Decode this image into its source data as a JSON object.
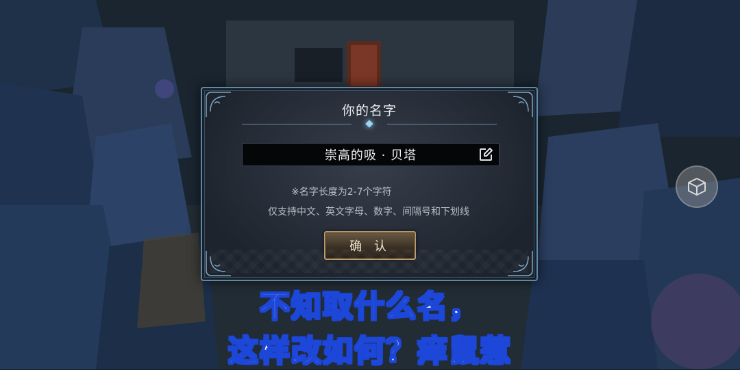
{
  "dialog": {
    "title": "你的名字",
    "name_value": "崇高的吸 · 贝塔",
    "hint_length": "※名字长度为2-7个字符",
    "hint_chars": "仅支持中文、英文字母、数字、间隔号和下划线",
    "confirm_label": "确 认"
  },
  "icons": {
    "edit": "edit-icon",
    "side_button": "cube-icon"
  },
  "subtitles": {
    "line1": "不知取什么名，",
    "line2": "这样改如何？痒鼠惹"
  },
  "colors": {
    "dialog_border": "#5e8aa8",
    "button_border": "#b89a6a",
    "subtitle_text": "#ffffff",
    "subtitle_stroke": "#1d47d8"
  }
}
